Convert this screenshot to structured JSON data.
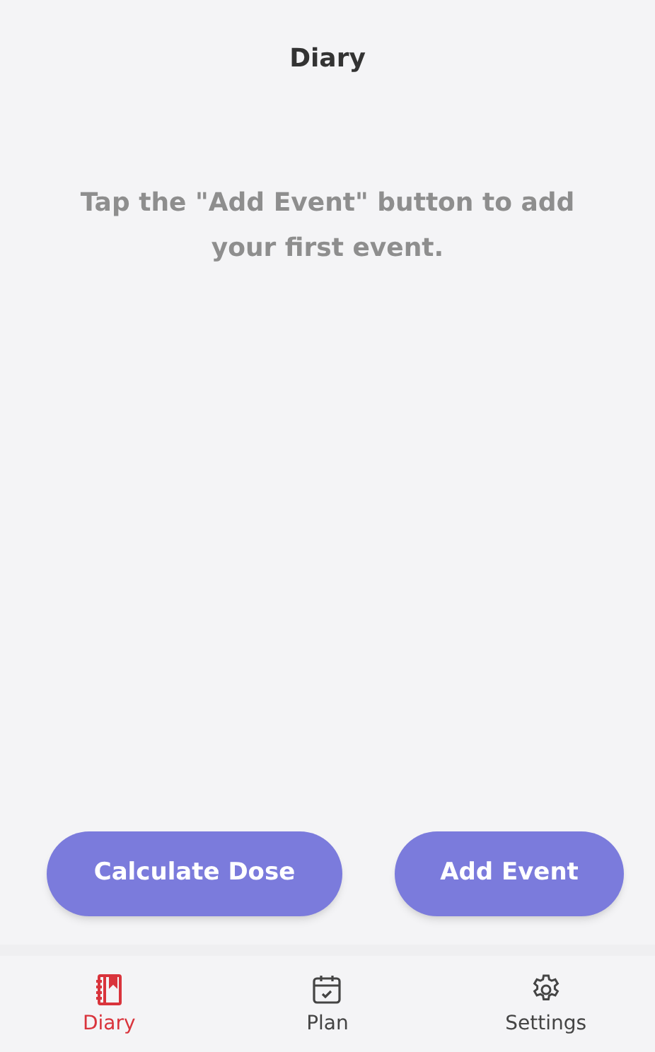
{
  "header": {
    "title": "Diary"
  },
  "empty_message": "Tap the \"Add Event\" button to add your first event.",
  "actions": [
    {
      "label": "Calculate Dose"
    },
    {
      "label": "Add Event"
    }
  ],
  "tabs": [
    {
      "label": "Diary",
      "selected": true
    },
    {
      "label": "Plan",
      "selected": false
    },
    {
      "label": "Settings",
      "selected": false
    }
  ]
}
